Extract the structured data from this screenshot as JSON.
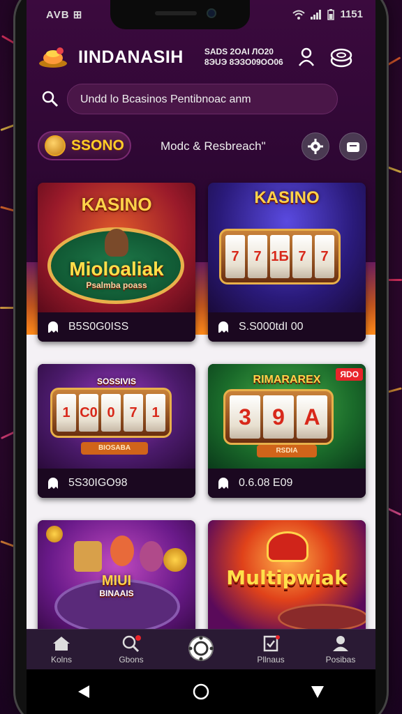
{
  "status_bar": {
    "left_text": "AVB ⊞",
    "right_text": "1151"
  },
  "header": {
    "title": "IINDANASIH",
    "balance_line1": "SADS 2OAI ЛO20",
    "balance_line2": "8ЭUЭ 8ЭЗО09ОО06"
  },
  "search": {
    "text": "Undd lo Bcasinos Pentibnoac anm"
  },
  "filters": {
    "casino_pill": "SSONO",
    "mode_label": "Modc & Resbreach\""
  },
  "cards": [
    {
      "art_title": "KASINO",
      "art_sub": "Mioloaliak",
      "art_sub2": "Psalmba poass",
      "meta": "B5S0G0ISS"
    },
    {
      "art_title": "KASINO",
      "meta": "S.S000tdI 00"
    },
    {
      "art_title": "SOSSIVIS",
      "art_button": "BIOSABA",
      "meta": "5S30IGO98"
    },
    {
      "art_title": "RIMARAREX",
      "art_corner": "ЯDO",
      "reels": [
        "3",
        "9",
        "A"
      ],
      "art_button": "RSDIA",
      "meta": "0.6.08 E09"
    },
    {
      "art_title": "MIUI",
      "art_sub": "BINAAIS"
    },
    {
      "art_title": "Multipwiak"
    }
  ],
  "reels_card2": [
    "7",
    "7",
    "1Б",
    "7",
    "7"
  ],
  "reels_card3": [
    "1",
    "C0",
    "0",
    "7",
    "1"
  ],
  "bottom_nav": [
    {
      "label": "Kolns",
      "icon": "home-icon"
    },
    {
      "label": "Gbons",
      "icon": "search-icon"
    },
    {
      "label": "",
      "icon": "poker-chip-icon"
    },
    {
      "label": "Pllnaus",
      "icon": "checklist-icon"
    },
    {
      "label": "Posibas",
      "icon": "profile-icon"
    }
  ],
  "colors": {
    "gold": "#ffd34a",
    "purple_bg": "#2a0630",
    "nav_bg": "#2a1a34"
  }
}
